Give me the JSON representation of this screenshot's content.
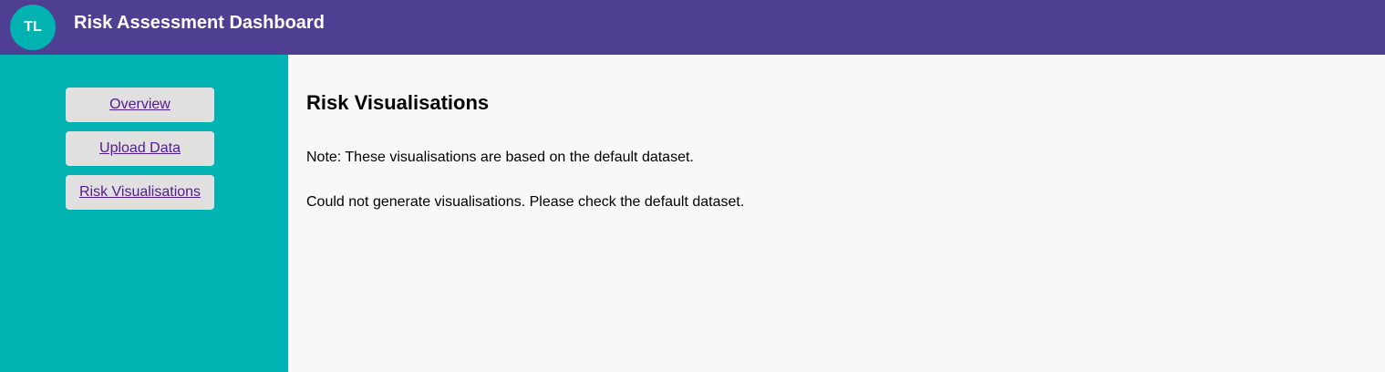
{
  "header": {
    "logo_text": "TL",
    "title": "Risk Assessment Dashboard"
  },
  "sidebar": {
    "items": [
      {
        "label": "Overview"
      },
      {
        "label": "Upload Data"
      },
      {
        "label": "Risk Visualisations"
      }
    ]
  },
  "main": {
    "title": "Risk Visualisations",
    "note": "Note: These visualisations are based on the default dataset.",
    "error": "Could not generate visualisations. Please check the default dataset."
  },
  "colors": {
    "header_bg": "#4e3f92",
    "accent": "#00b2b2",
    "nav_button_bg": "#e0e0e0",
    "link": "#551a8b",
    "main_bg": "#f8f8f8"
  }
}
